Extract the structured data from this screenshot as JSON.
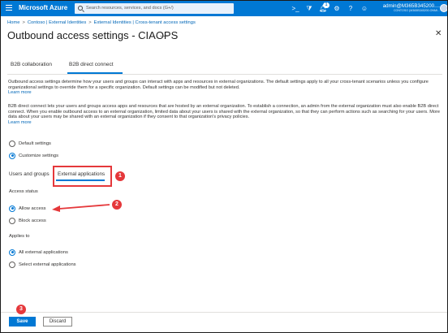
{
  "topbar": {
    "brand": "Microsoft Azure",
    "search_placeholder": "Search resources, services, and docs (G+/)",
    "notification_count": "1",
    "user": "admin@M365B345200....",
    "org": "CONTOSO (M365B345200.ONMI...",
    "icons": [
      "menu-icon",
      "search-icon",
      "cloud-shell-icon",
      "filter-icon",
      "bell-icon",
      "gear-icon",
      "help-icon",
      "feedback-icon"
    ]
  },
  "breadcrumb": [
    "Home",
    "Contoso | External Identities",
    "External Identities | Cross-tenant access settings"
  ],
  "page": {
    "title": "Outbound access settings - CIAOPS",
    "more": "...",
    "close": "✕"
  },
  "tabs": [
    "B2B collaboration",
    "B2B direct connect"
  ],
  "paragraphs": {
    "p1": "Outbound access settings determine how your users and groups can interact with apps and resources in external organizations. The default settings apply to all your cross-tenant scenarios unless you configure organizational settings to override them for a specific organization. Default settings can be modified but not deleted.",
    "p1_link": "Learn more",
    "p2": "B2B direct connect lets your users and groups access apps and resources that are hosted by an external organization. To establish a connection, an admin from the external organization must also enable B2B direct connect. When you enable outbound access to an external organization, limited data about your users is shared with the external organization, so that they can perform actions such as searching for your users. More data about your users may be shared with an external organization if they consent to that organization's privacy policies.",
    "p2_link": "Learn more"
  },
  "settings_mode": {
    "options": [
      "Default settings",
      "Customize settings"
    ],
    "selected": "Customize settings"
  },
  "subtabs": [
    "Users and groups",
    "External applications"
  ],
  "access_status": {
    "label": "Access status",
    "options": [
      "Allow access",
      "Block access"
    ],
    "selected": "Allow access"
  },
  "applies_to": {
    "label": "Applies to",
    "options": [
      "All external applications",
      "Select external applications"
    ],
    "selected": "All external applications"
  },
  "callouts": [
    "1",
    "2",
    "3"
  ],
  "footer": {
    "save": "Save",
    "discard": "Discard"
  },
  "colors": {
    "azure_blue": "#0078d4",
    "annotation_red": "#e5383b"
  }
}
